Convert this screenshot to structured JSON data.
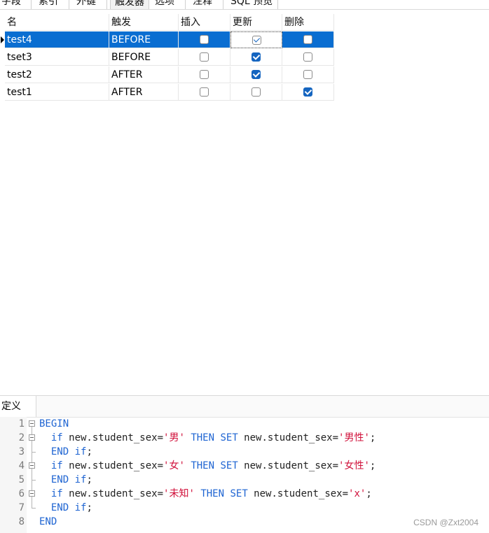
{
  "tabs": [
    {
      "label": "字段",
      "active": false
    },
    {
      "label": "索引",
      "active": false
    },
    {
      "label": "外键",
      "active": false
    },
    {
      "label": "触发器",
      "active": true
    },
    {
      "label": "选项",
      "active": false
    },
    {
      "label": "注释",
      "active": false
    },
    {
      "label": "SQL 预览",
      "active": false
    }
  ],
  "grid": {
    "columns": [
      "名",
      "触发",
      "插入",
      "更新",
      "删除"
    ],
    "rows": [
      {
        "name": "test4",
        "timing": "BEFORE",
        "insert": false,
        "update": true,
        "delete": false,
        "selected": true
      },
      {
        "name": "tset3",
        "timing": "BEFORE",
        "insert": false,
        "update": true,
        "delete": false,
        "selected": false
      },
      {
        "name": "test2",
        "timing": "AFTER",
        "insert": false,
        "update": true,
        "delete": false,
        "selected": false
      },
      {
        "name": "test1",
        "timing": "AFTER",
        "insert": false,
        "update": false,
        "delete": true,
        "selected": false
      }
    ]
  },
  "definition": {
    "tab_label": "定义",
    "lines": [
      {
        "n": "1",
        "fold": "open",
        "indent": "",
        "tokens": [
          {
            "t": "BEGIN",
            "c": "kw"
          }
        ]
      },
      {
        "n": "2",
        "fold": "open",
        "indent": "  ",
        "tokens": [
          {
            "t": "if",
            "c": "kw"
          },
          {
            "t": " new.student_sex=",
            "c": "plain"
          },
          {
            "t": "'男'",
            "c": "str"
          },
          {
            "t": " ",
            "c": "plain"
          },
          {
            "t": "THEN SET",
            "c": "kw"
          },
          {
            "t": " new.student_sex=",
            "c": "plain"
          },
          {
            "t": "'男性'",
            "c": "str"
          },
          {
            "t": ";",
            "c": "plain"
          }
        ]
      },
      {
        "n": "3",
        "fold": "end",
        "indent": "  ",
        "tokens": [
          {
            "t": "END if",
            "c": "kw"
          },
          {
            "t": ";",
            "c": "plain"
          }
        ]
      },
      {
        "n": "4",
        "fold": "open",
        "indent": "  ",
        "tokens": [
          {
            "t": "if",
            "c": "kw"
          },
          {
            "t": " new.student_sex=",
            "c": "plain"
          },
          {
            "t": "'女'",
            "c": "str"
          },
          {
            "t": " ",
            "c": "plain"
          },
          {
            "t": "THEN SET",
            "c": "kw"
          },
          {
            "t": " new.student_sex=",
            "c": "plain"
          },
          {
            "t": "'女性'",
            "c": "str"
          },
          {
            "t": ";",
            "c": "plain"
          }
        ]
      },
      {
        "n": "5",
        "fold": "end",
        "indent": "  ",
        "tokens": [
          {
            "t": "END if",
            "c": "kw"
          },
          {
            "t": ";",
            "c": "plain"
          }
        ]
      },
      {
        "n": "6",
        "fold": "open",
        "indent": "  ",
        "tokens": [
          {
            "t": "if",
            "c": "kw"
          },
          {
            "t": " new.student_sex=",
            "c": "plain"
          },
          {
            "t": "'未知'",
            "c": "str"
          },
          {
            "t": " ",
            "c": "plain"
          },
          {
            "t": "THEN SET",
            "c": "kw"
          },
          {
            "t": " new.student_sex=",
            "c": "plain"
          },
          {
            "t": "'x'",
            "c": "str"
          },
          {
            "t": ";",
            "c": "plain"
          }
        ]
      },
      {
        "n": "7",
        "fold": "end",
        "indent": "  ",
        "tokens": [
          {
            "t": "END if",
            "c": "kw"
          },
          {
            "t": ";",
            "c": "plain"
          }
        ]
      },
      {
        "n": "8",
        "fold": "none",
        "indent": "",
        "tokens": [
          {
            "t": "END",
            "c": "kw"
          }
        ]
      }
    ]
  },
  "watermark": "CSDN @Zxt2004",
  "colors": {
    "selection": "#0a6ed1",
    "keyword": "#1e64d2",
    "string": "#d0103a",
    "checkbox": "#1565c0"
  }
}
